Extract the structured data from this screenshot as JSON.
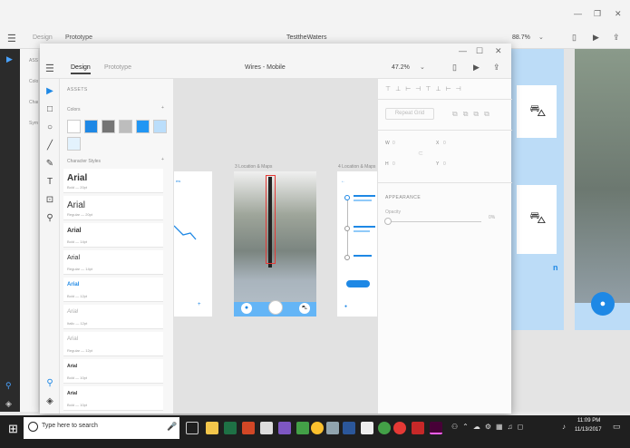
{
  "bg_window": {
    "tabs": [
      "Design",
      "Prototype"
    ],
    "document_title": "TesttheWaters",
    "zoom": "88.7%",
    "side_labels": [
      "ASS",
      "Colo",
      "Char",
      "Syml"
    ]
  },
  "fg_window": {
    "tabs": [
      "Design",
      "Prototype"
    ],
    "document_title": "Wires - Mobile",
    "zoom": "47.2%",
    "assets_header": "ASSETS",
    "colors_header": "Colors",
    "char_styles_header": "Character Styles",
    "colors": [
      "#ffffff",
      "#1e88e5",
      "#757575",
      "#bdbdbd",
      "#2196f3",
      "#bbdefb",
      "#e3f2fd"
    ],
    "character_styles": [
      {
        "name": "Arial",
        "meta": "Bold — 20pt"
      },
      {
        "name": "Arial",
        "meta": "Regular — 20pt"
      },
      {
        "name": "Arial",
        "meta": "Bold — 14pt"
      },
      {
        "name": "Arial",
        "meta": "Regular — 14pt"
      },
      {
        "name": "Arial",
        "meta": "Bold — 12pt"
      },
      {
        "name": "Arial",
        "meta": "Italic — 12pt"
      },
      {
        "name": "Arial",
        "meta": "Regular — 12pt"
      },
      {
        "name": "Arial",
        "meta": "Bold — 10pt"
      },
      {
        "name": "Arial",
        "meta": "Bold — 10pt"
      }
    ],
    "artboards": [
      "3 Location & Maps",
      "4 Location & Maps"
    ],
    "props": {
      "repeat_grid": "Repeat Grid",
      "w_label": "W",
      "w_value": "0",
      "h_label": "H",
      "h_value": "0",
      "x_label": "X",
      "x_value": "0",
      "y_label": "Y",
      "y_value": "0",
      "appearance": "APPEARANCE",
      "opacity_label": "Opacity",
      "opacity_value": "0%"
    }
  },
  "taskbar": {
    "search_placeholder": "Type here to search",
    "time": "11:09 PM",
    "date": "11/13/2017"
  }
}
